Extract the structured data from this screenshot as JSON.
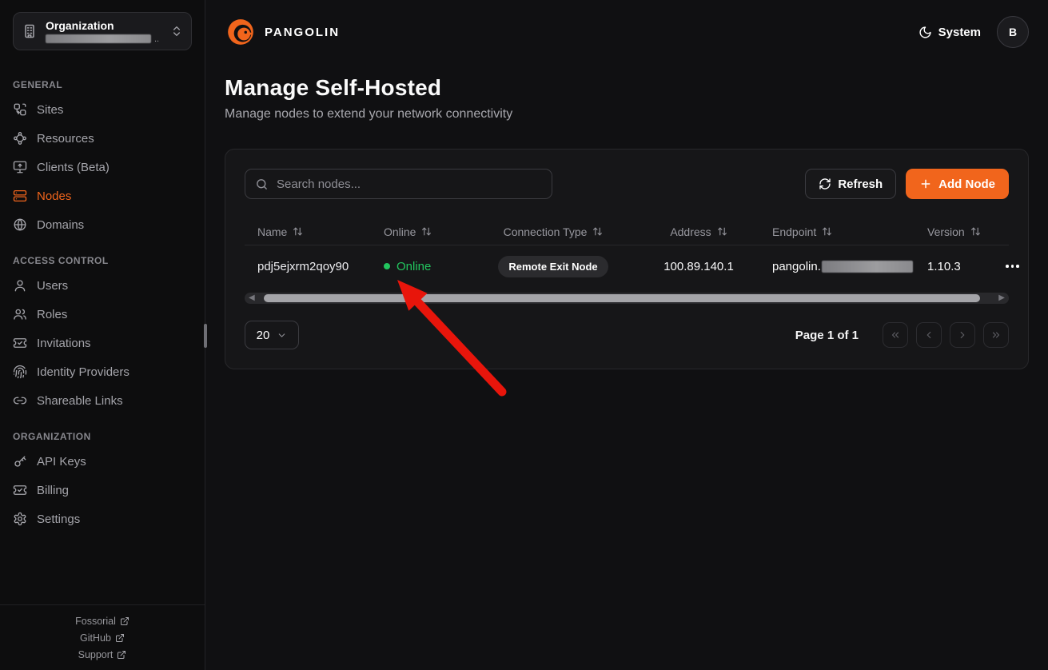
{
  "colors": {
    "accent": "#f1651c",
    "online_green": "#22c55e",
    "arrow_red": "#e8150b"
  },
  "org_switcher": {
    "title": "Organization",
    "redacted_suffix": ".."
  },
  "sidebar": {
    "sections": [
      {
        "heading": "GENERAL",
        "items": [
          {
            "label": "Sites",
            "icon": "sites-icon"
          },
          {
            "label": "Resources",
            "icon": "resources-icon"
          },
          {
            "label": "Clients (Beta)",
            "icon": "clients-icon"
          },
          {
            "label": "Nodes",
            "icon": "nodes-icon",
            "active": true
          },
          {
            "label": "Domains",
            "icon": "domains-icon"
          }
        ]
      },
      {
        "heading": "ACCESS CONTROL",
        "items": [
          {
            "label": "Users",
            "icon": "user-icon"
          },
          {
            "label": "Roles",
            "icon": "roles-icon"
          },
          {
            "label": "Invitations",
            "icon": "invitations-icon"
          },
          {
            "label": "Identity Providers",
            "icon": "fingerprint-icon"
          },
          {
            "label": "Shareable Links",
            "icon": "link-icon"
          }
        ]
      },
      {
        "heading": "ORGANIZATION",
        "items": [
          {
            "label": "API Keys",
            "icon": "key-icon"
          },
          {
            "label": "Billing",
            "icon": "billing-icon"
          },
          {
            "label": "Settings",
            "icon": "gear-icon"
          }
        ]
      }
    ],
    "footer_links": [
      {
        "label": "Fossorial",
        "icon": "external-link-icon"
      },
      {
        "label": "GitHub",
        "icon": "external-link-icon"
      },
      {
        "label": "Support",
        "icon": "external-link-icon"
      }
    ]
  },
  "header": {
    "brand": "PANGOLIN",
    "theme_toggle_label": "System",
    "avatar_initial": "B"
  },
  "page": {
    "title": "Manage Self-Hosted",
    "subtitle": "Manage nodes to extend your network connectivity"
  },
  "toolbar": {
    "search_placeholder": "Search nodes...",
    "refresh_label": "Refresh",
    "add_node_label": "Add Node"
  },
  "table": {
    "columns": [
      {
        "label": "Name"
      },
      {
        "label": "Online"
      },
      {
        "label": "Connection Type"
      },
      {
        "label": "Address"
      },
      {
        "label": "Endpoint"
      },
      {
        "label": "Version"
      }
    ],
    "rows": [
      {
        "name": "pdj5ejxrm2qoy90",
        "online_status": "Online",
        "connection_type": "Remote Exit Node",
        "address": "100.89.140.1",
        "endpoint_prefix": "pangolin.",
        "endpoint_redacted": true,
        "version": "1.10.3"
      }
    ]
  },
  "pagination": {
    "page_size": "20",
    "page_label": "Page 1 of 1"
  },
  "annotation": {
    "type": "red-arrow",
    "points_to": "online-status"
  }
}
